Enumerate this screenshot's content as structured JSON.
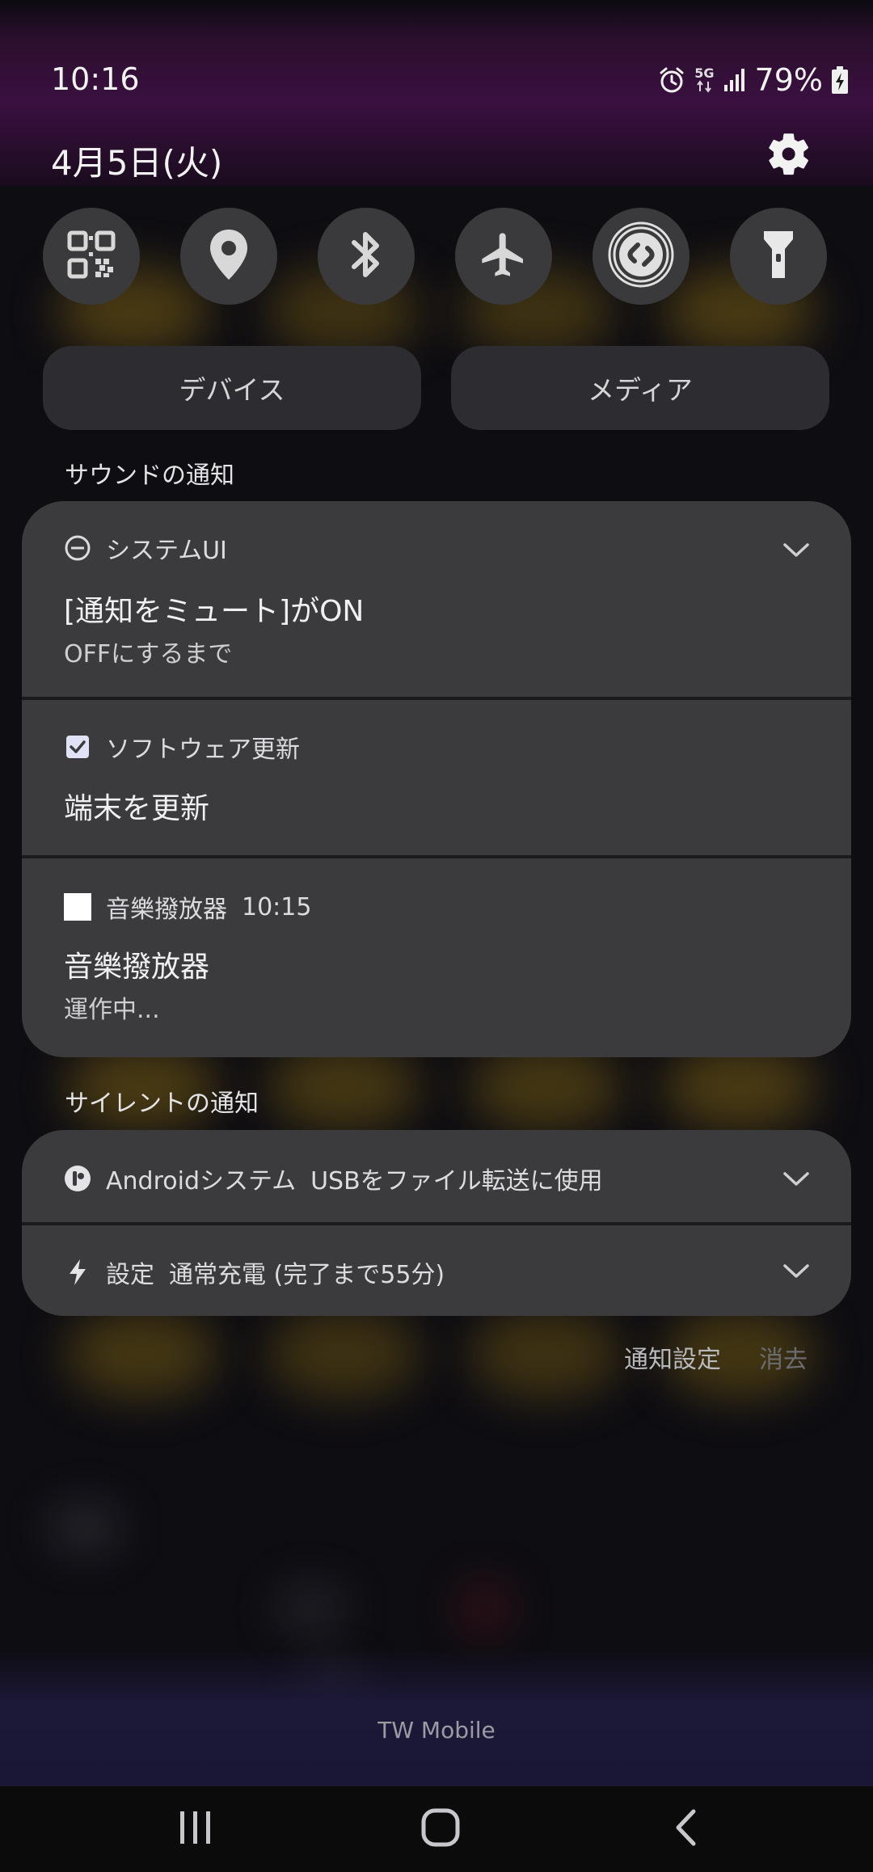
{
  "status_bar": {
    "time": "10:16",
    "network": "5G",
    "battery": "79%",
    "icons": [
      "alarm-icon",
      "5g-data-icon",
      "signal-icon",
      "battery-charging-icon"
    ]
  },
  "header": {
    "date": "4月5日(火)",
    "settings_icon": "gear-icon"
  },
  "quick_settings": {
    "tiles": [
      {
        "name": "qr-scanner",
        "icon": "qr-code-icon"
      },
      {
        "name": "location",
        "icon": "location-pin-icon"
      },
      {
        "name": "bluetooth",
        "icon": "bluetooth-icon"
      },
      {
        "name": "airplane-mode",
        "icon": "airplane-icon"
      },
      {
        "name": "shazam",
        "icon": "shazam-icon"
      },
      {
        "name": "flashlight",
        "icon": "flashlight-icon"
      }
    ],
    "device_label": "デバイス",
    "media_label": "メディア"
  },
  "sound_section": {
    "label": "サウンドの通知",
    "notifications": [
      {
        "app": "システムUI",
        "title": "[通知をミュート]がON",
        "subtitle": "OFFにするまで",
        "icon": "do-not-disturb-icon"
      },
      {
        "app": "ソフトウェア更新",
        "title": "端末を更新",
        "icon": "checkbox-icon"
      },
      {
        "app": "音樂撥放器",
        "time": "10:15",
        "title": "音樂撥放器",
        "subtitle": "運作中...",
        "icon": "blank-app-icon"
      }
    ]
  },
  "silent_section": {
    "label": "サイレントの通知",
    "notifications": [
      {
        "app": "Androidシステム",
        "text": "USBをファイル転送に使用",
        "icon": "android-system-icon"
      },
      {
        "app": "設定",
        "text": "通常充電 (完了まで55分)",
        "icon": "lightning-icon"
      }
    ]
  },
  "actions": {
    "notification_settings": "通知設定",
    "clear": "消去"
  },
  "carrier": "TW Mobile",
  "nav": {
    "recents": "recents-icon",
    "home": "home-icon",
    "back": "back-icon"
  },
  "colors": {
    "card": "#3b3b3d",
    "tile": "#3a3a3c",
    "accent_top": "#3a1040"
  }
}
